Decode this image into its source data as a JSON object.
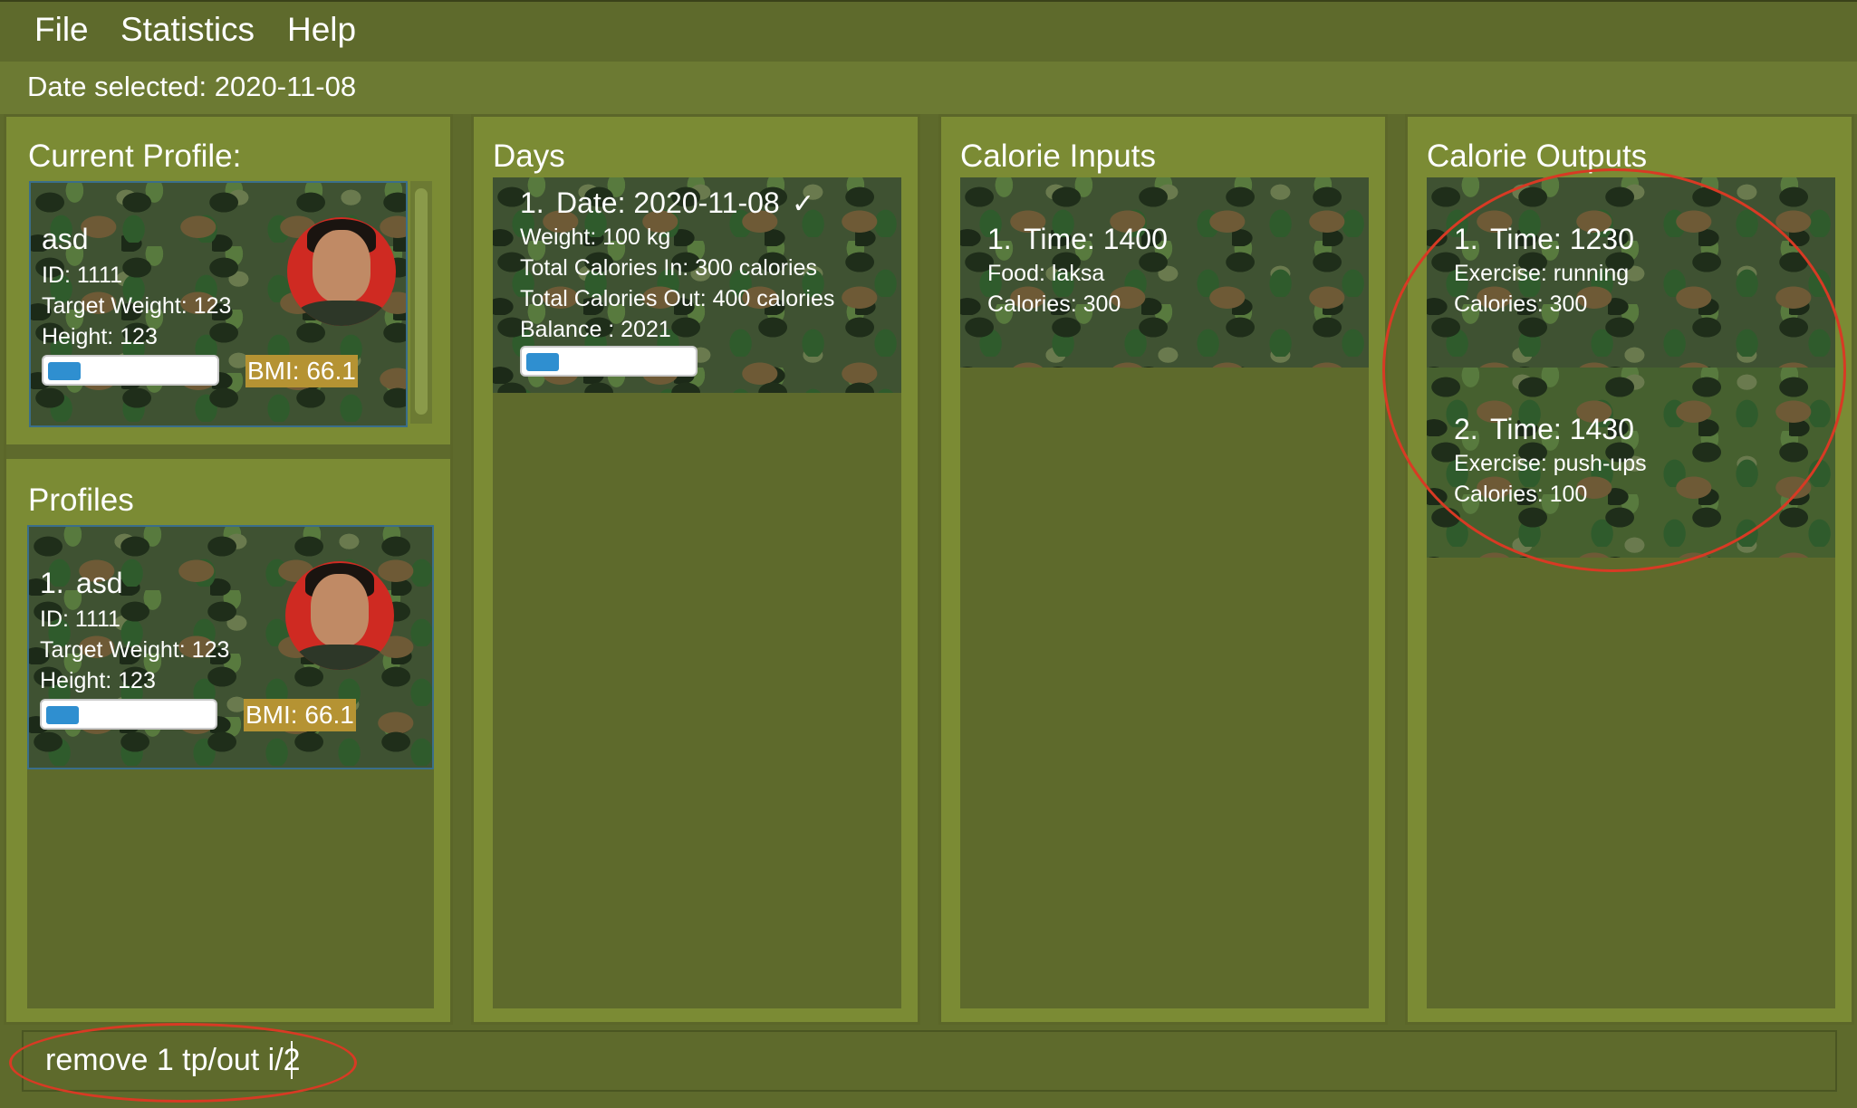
{
  "menu": {
    "file": "File",
    "statistics": "Statistics",
    "help": "Help"
  },
  "date_selected": "Date selected: 2020-11-08",
  "current_profile": {
    "title": "Current Profile:",
    "name": "asd",
    "id": "ID: 1111",
    "target_weight": "Target Weight: 123",
    "height": "Height: 123",
    "bmi": "BMI: 66.1",
    "progress_fraction": 0.2
  },
  "profiles": {
    "title": "Profiles",
    "items": [
      {
        "index": "1.",
        "name": "asd",
        "id": "ID: 1111",
        "target_weight": "Target Weight: 123",
        "height": "Height: 123",
        "bmi": "BMI: 66.1",
        "progress_fraction": 0.2
      }
    ]
  },
  "days": {
    "title": "Days",
    "items": [
      {
        "index": "1.",
        "date": "Date: 2020-11-08",
        "check": "✓",
        "weight": "Weight: 100 kg",
        "calories_in": "Total Calories In: 300 calories",
        "calories_out": "Total Calories Out: 400 calories",
        "balance": "Balance : 2021",
        "progress_fraction": 0.2
      }
    ]
  },
  "calorie_inputs": {
    "title": "Calorie Inputs",
    "items": [
      {
        "index": "1.",
        "time": "Time: 1400",
        "food": "Food: laksa",
        "calories": "Calories: 300"
      }
    ]
  },
  "calorie_outputs": {
    "title": "Calorie Outputs",
    "items": [
      {
        "index": "1.",
        "time": "Time: 1230",
        "exercise": "Exercise: running",
        "calories": "Calories: 300"
      },
      {
        "index": "2.",
        "time": "Time: 1430",
        "exercise": "Exercise: push-ups",
        "calories": "Calories: 100"
      }
    ]
  },
  "command": {
    "value": "remove 1 tp/out i/2"
  },
  "colors": {
    "background": "#5e6a2c",
    "panel": "#7b8b34",
    "bmi_badge": "#b59333",
    "progress_fill": "#2f8fd0",
    "annotation_ring": "#d83a24",
    "check": "#4caf50"
  },
  "icons": {
    "avatar": "profile-photo",
    "check": "check-icon"
  }
}
